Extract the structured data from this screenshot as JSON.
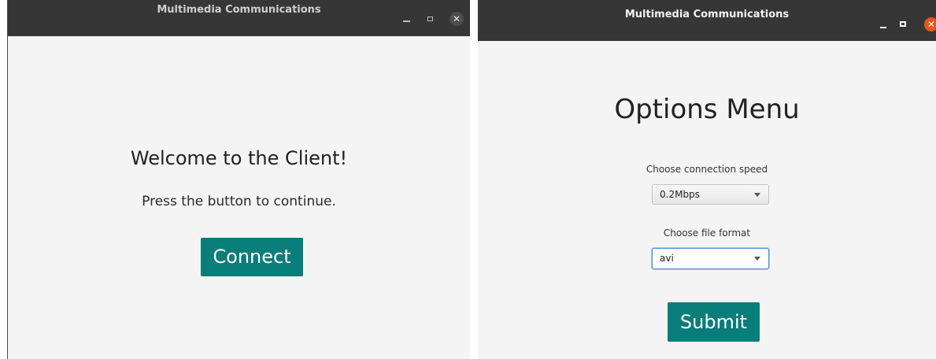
{
  "windows": [
    {
      "title": "Multimedia Communications",
      "welcome_heading": "Welcome to the Client!",
      "instruction": "Press the button to continue.",
      "connect_label": "Connect"
    },
    {
      "title": "Multimedia Communications",
      "heading": "Options Menu",
      "speed_label": "Choose connection speed",
      "speed_value": "0.2Mbps",
      "format_label": "Choose file format",
      "format_value": "avi",
      "submit_label": "Submit"
    }
  ],
  "window_controls": {
    "minimize_icon": "minimize-icon",
    "maximize_icon": "maximize-icon",
    "close_icon": "close-icon",
    "close_glyph": "✕"
  },
  "colors": {
    "accent_button": "#097d79",
    "titlebar": "#363636",
    "close_active": "#e95420"
  }
}
